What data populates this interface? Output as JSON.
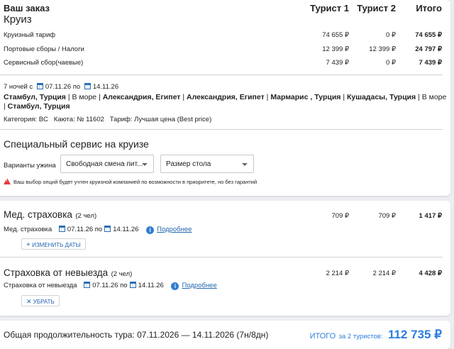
{
  "order": {
    "heading": "Ваш заказ",
    "product": "Круиз",
    "col_tourist1": "Турист 1",
    "col_tourist2": "Турист 2",
    "col_total": "Итого",
    "rows": [
      {
        "label": "Круизный тариф",
        "t1": "74 655 ₽",
        "t2": "0 ₽",
        "total": "74 655 ₽"
      },
      {
        "label": "Портовые сборы / Налоги",
        "t1": "12 399 ₽",
        "t2": "12 399 ₽",
        "total": "24 797 ₽"
      },
      {
        "label": "Сервисный сбор(чаевые)",
        "t1": "7 439 ₽",
        "t2": "0 ₽",
        "total": "7 439 ₽"
      }
    ],
    "nights_prefix": "7 ночей с",
    "date_from": "07.11.26",
    "date_to_word": "по",
    "date_to": "14.11.26",
    "route": [
      {
        "port": "Стамбул, Турция",
        "bold": true
      },
      {
        "port": " | ",
        "bold": false
      },
      {
        "port": "В море",
        "bold": false
      },
      {
        "port": " | ",
        "bold": false
      },
      {
        "port": "Александрия, Египет",
        "bold": true
      },
      {
        "port": " | ",
        "bold": false
      },
      {
        "port": "Александрия, Египет",
        "bold": true
      },
      {
        "port": " | ",
        "bold": false
      },
      {
        "port": "Мармарис , Турция",
        "bold": true
      },
      {
        "port": " | ",
        "bold": false
      },
      {
        "port": "Кушадасы, Турция",
        "bold": true
      },
      {
        "port": " | ",
        "bold": false
      },
      {
        "port": "В море",
        "bold": false
      },
      {
        "port": " | ",
        "bold": false
      },
      {
        "port": "Стамбул, Турция",
        "bold": true
      }
    ],
    "cabin_info": "Категория: BC   Каюта: № 11602   Тариф: Лучшая цена (Best price)"
  },
  "special": {
    "title": "Специальный сервис на круизе",
    "dinner_label": "Варианты ужина",
    "dinner_value": "Свободная смена пит...",
    "table_value": "Размер стола",
    "warning": "Ваш выбор опций будет учтен круизной компанией по возможности в приоритете, но без гарантий"
  },
  "medical": {
    "title": "Мед. страховка",
    "persons": "(2 чел)",
    "t1": "709 ₽",
    "t2": "709 ₽",
    "total": "1 417 ₽",
    "sub_label": "Мед. страховка",
    "date_from": "07.11.26",
    "date_to_word": "по",
    "date_to": "14.11.26",
    "more_link": "Подробнее",
    "change_dates": "ИЗМЕНИТЬ ДАТЫ"
  },
  "cancellation": {
    "title": "Страховка от невыезда",
    "persons": "(2 чел)",
    "t1": "2 214 ₽",
    "t2": "2 214 ₽",
    "total": "4 428 ₽",
    "sub_label": "Страховка от невыезда",
    "date_from": "07.11.26",
    "date_to_word": "по",
    "date_to": "14.11.26",
    "more_link": "Подробнее",
    "remove": "УБРАТЬ"
  },
  "footer": {
    "duration": "Общая продолжительность тура: 07.11.2026 — 14.11.2026 (7н/8дн)",
    "total_label": "ИТОГО",
    "for_tourists": "за 2 туристов:",
    "total_value": "112 735 ₽"
  },
  "colors": {
    "accent": "#2b7de0",
    "link": "#2366b0",
    "warning": "#e23b3b",
    "background": "#eceef1"
  }
}
